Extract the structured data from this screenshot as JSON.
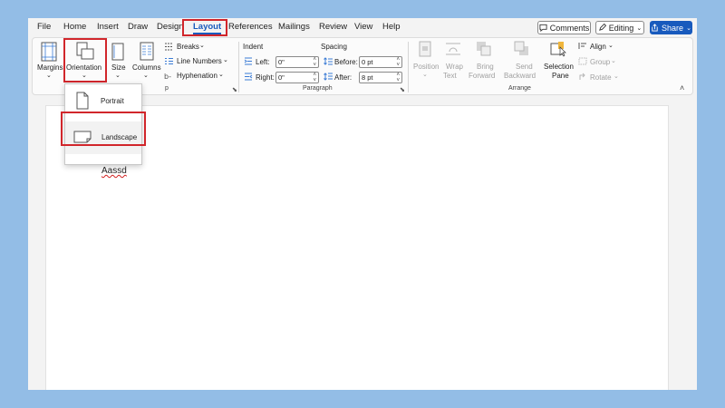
{
  "menu": {
    "tabs": [
      {
        "label": "File"
      },
      {
        "label": "Home"
      },
      {
        "label": "Insert"
      },
      {
        "label": "Draw"
      },
      {
        "label": "Design"
      },
      {
        "label": "Layout"
      },
      {
        "label": "References"
      },
      {
        "label": "Mailings"
      },
      {
        "label": "Review"
      },
      {
        "label": "View"
      },
      {
        "label": "Help"
      }
    ],
    "active_tab": "Layout",
    "comments_label": "Comments",
    "editing_label": "Editing",
    "share_label": "Share"
  },
  "ribbon": {
    "page_setup": {
      "margins": "Margins",
      "orientation": "Orientation",
      "size": "Size",
      "columns": "Columns",
      "breaks": "Breaks",
      "line_numbers": "Line Numbers",
      "hyphenation": "Hyphenation",
      "group_label_partial": "p"
    },
    "paragraph": {
      "indent_heading": "Indent",
      "spacing_heading": "Spacing",
      "left_label": "Left:",
      "right_label": "Right:",
      "before_label": "Before:",
      "after_label": "After:",
      "left_value": "0\"",
      "right_value": "0\"",
      "before_value": "0 pt",
      "after_value": "8 pt",
      "group_label": "Paragraph"
    },
    "arrange": {
      "position": "Position",
      "wrap_text_1": "Wrap",
      "wrap_text_2": "Text",
      "bring_forward_1": "Bring",
      "bring_forward_2": "Forward",
      "send_backward_1": "Send",
      "send_backward_2": "Backward",
      "selection_pane_1": "Selection",
      "selection_pane_2": "Pane",
      "align": "Align",
      "group": "Group",
      "rotate": "Rotate",
      "group_label": "Arrange"
    }
  },
  "orientation_menu": {
    "options": [
      {
        "label": "Portrait"
      },
      {
        "label": "Landscape"
      }
    ],
    "highlighted": "Landscape"
  },
  "document": {
    "text": "Aassd"
  },
  "colors": {
    "accent": "#185abd",
    "highlight_box": "#d1262b",
    "background": "#93bde6"
  }
}
